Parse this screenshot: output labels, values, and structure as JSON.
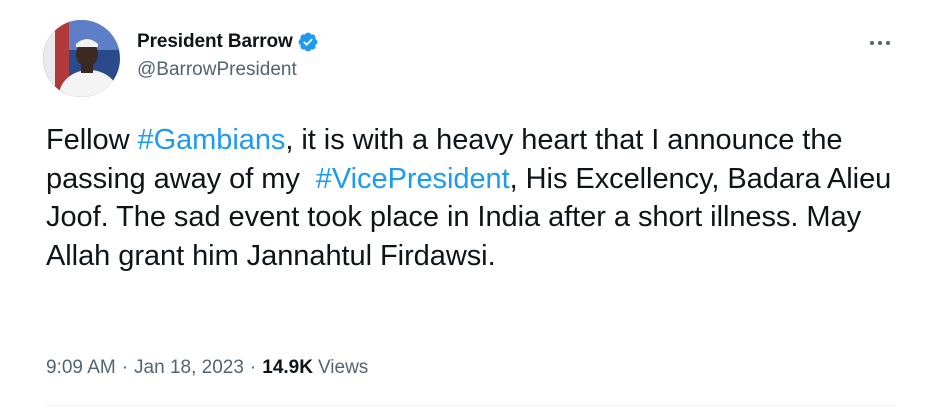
{
  "author": {
    "display_name": "President Barrow",
    "handle": "@BarrowPresident",
    "verified": true,
    "verified_icon": "verified-badge-icon"
  },
  "tweet": {
    "segments": [
      {
        "type": "text",
        "value": "Fellow "
      },
      {
        "type": "hashtag",
        "value": "#Gambians"
      },
      {
        "type": "text",
        "value": ", it is with a heavy heart that I announce the passing away of my  "
      },
      {
        "type": "hashtag",
        "value": "#VicePresident"
      },
      {
        "type": "text",
        "value": ", His Excellency, Badara Alieu Joof. The sad event took place in India after a short illness. May Allah grant him Jannahtul Firdawsi."
      }
    ]
  },
  "meta": {
    "time": "9:09 AM",
    "separator": "·",
    "date": "Jan 18, 2023",
    "views_count": "14.9K",
    "views_label": "Views"
  },
  "menu": {
    "more_icon": "more-horizontal-icon"
  },
  "colors": {
    "link": "#1d9bf0",
    "verified": "#1d9bf0",
    "secondary_text": "#536471",
    "primary_text": "#0f1419",
    "divider": "#eff3f4"
  }
}
